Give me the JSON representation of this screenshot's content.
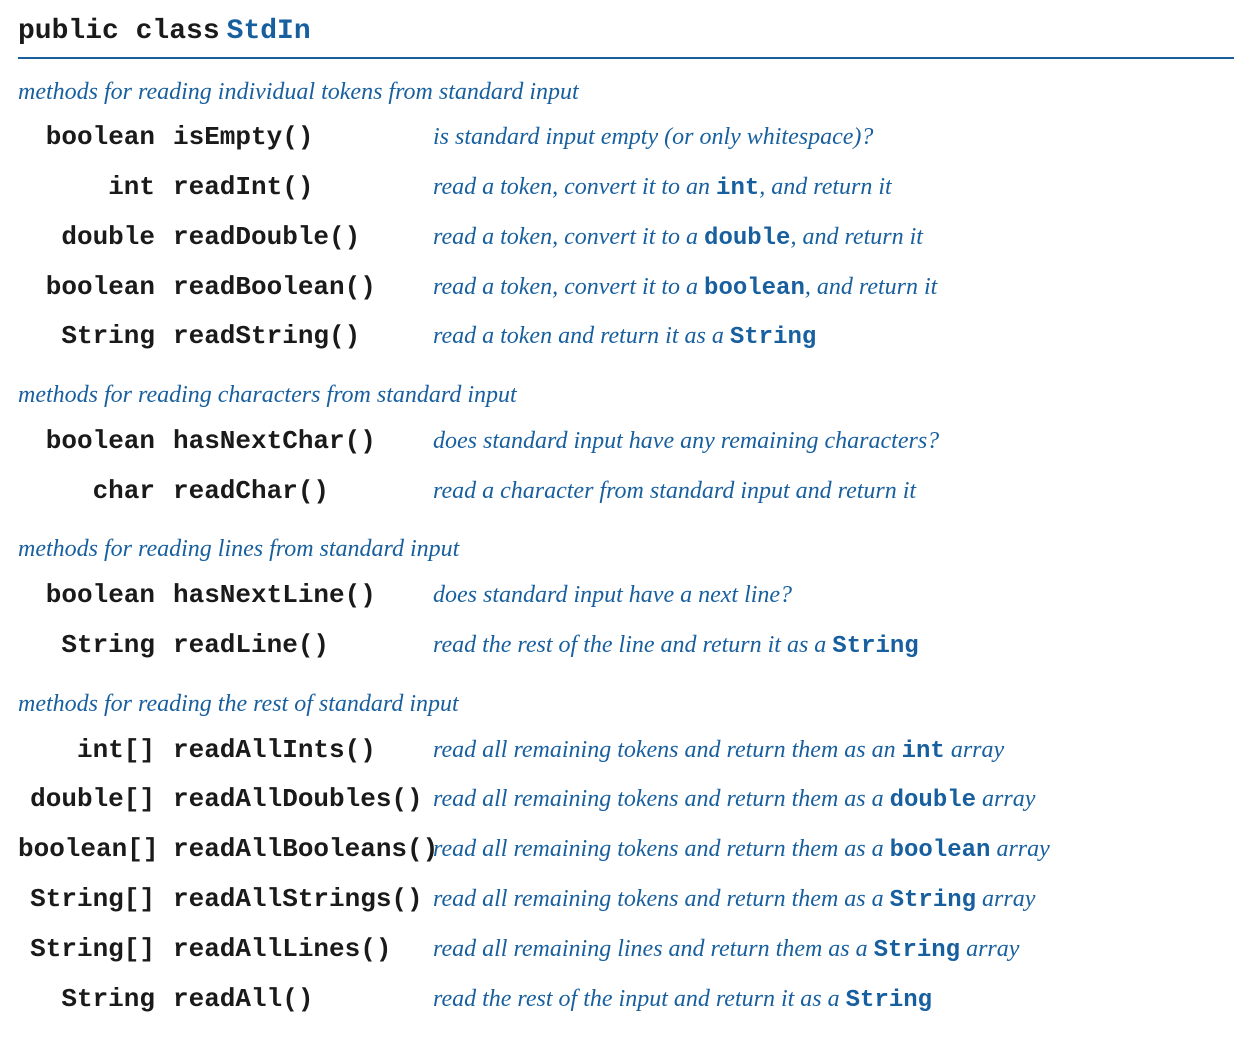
{
  "header": {
    "modifiers": "public class",
    "class_name": "StdIn"
  },
  "sections": [
    {
      "title": "methods for reading individual tokens from standard input",
      "methods": [
        {
          "return_type": "boolean",
          "name": "isEmpty()",
          "desc_parts": [
            {
              "t": "text",
              "v": "is standard input empty (or only whitespace)?"
            }
          ]
        },
        {
          "return_type": "int",
          "name": "readInt()",
          "desc_parts": [
            {
              "t": "text",
              "v": "read a token, convert it to an "
            },
            {
              "t": "code",
              "v": "int"
            },
            {
              "t": "text",
              "v": ", and return it"
            }
          ]
        },
        {
          "return_type": "double",
          "name": "readDouble()",
          "desc_parts": [
            {
              "t": "text",
              "v": "read a token, convert it to a "
            },
            {
              "t": "code",
              "v": "double"
            },
            {
              "t": "text",
              "v": ", and return it"
            }
          ]
        },
        {
          "return_type": "boolean",
          "name": "readBoolean()",
          "desc_parts": [
            {
              "t": "text",
              "v": "read a token, convert it to a "
            },
            {
              "t": "code",
              "v": "boolean"
            },
            {
              "t": "text",
              "v": ", and return it"
            }
          ]
        },
        {
          "return_type": "String",
          "name": "readString()",
          "desc_parts": [
            {
              "t": "text",
              "v": "read a token and return it as a "
            },
            {
              "t": "code",
              "v": "String"
            }
          ]
        }
      ]
    },
    {
      "title": "methods for reading characters from standard input",
      "methods": [
        {
          "return_type": "boolean",
          "name": "hasNextChar()",
          "desc_parts": [
            {
              "t": "text",
              "v": "does standard input have any remaining characters?"
            }
          ]
        },
        {
          "return_type": "char",
          "name": "readChar()",
          "desc_parts": [
            {
              "t": "text",
              "v": "read a character from standard input and return it"
            }
          ]
        }
      ]
    },
    {
      "title": "methods for reading lines from standard input",
      "methods": [
        {
          "return_type": "boolean",
          "name": "hasNextLine()",
          "desc_parts": [
            {
              "t": "text",
              "v": "does standard input have a next line?"
            }
          ]
        },
        {
          "return_type": "String",
          "name": "readLine()",
          "desc_parts": [
            {
              "t": "text",
              "v": "read the rest of the line and return it as a "
            },
            {
              "t": "code",
              "v": "String"
            }
          ]
        }
      ]
    },
    {
      "title": "methods for reading the rest of standard input",
      "methods": [
        {
          "return_type": "int[]",
          "name": "readAllInts()",
          "desc_parts": [
            {
              "t": "text",
              "v": "read all remaining tokens and return them as an "
            },
            {
              "t": "code",
              "v": "int"
            },
            {
              "t": "text",
              "v": " array"
            }
          ]
        },
        {
          "return_type": "double[]",
          "name": "readAllDoubles()",
          "desc_parts": [
            {
              "t": "text",
              "v": "read all remaining tokens and return them as a "
            },
            {
              "t": "code",
              "v": "double"
            },
            {
              "t": "text",
              "v": " array"
            }
          ]
        },
        {
          "return_type": "boolean[]",
          "name": "readAllBooleans()",
          "desc_parts": [
            {
              "t": "text",
              "v": "read all remaining tokens and return them as a "
            },
            {
              "t": "code",
              "v": "boolean"
            },
            {
              "t": "text",
              "v": " array"
            }
          ]
        },
        {
          "return_type": "String[]",
          "name": "readAllStrings()",
          "desc_parts": [
            {
              "t": "text",
              "v": "read all remaining tokens and return them as a "
            },
            {
              "t": "code",
              "v": "String"
            },
            {
              "t": "text",
              "v": " array"
            }
          ]
        },
        {
          "return_type": "String[]",
          "name": "readAllLines()",
          "desc_parts": [
            {
              "t": "text",
              "v": "read all remaining lines and return them as a "
            },
            {
              "t": "code",
              "v": "String"
            },
            {
              "t": "text",
              "v": " array"
            }
          ]
        },
        {
          "return_type": "String",
          "name": "readAll()",
          "desc_parts": [
            {
              "t": "text",
              "v": "read the rest of the input and return it as a "
            },
            {
              "t": "code",
              "v": "String"
            }
          ]
        }
      ]
    }
  ]
}
